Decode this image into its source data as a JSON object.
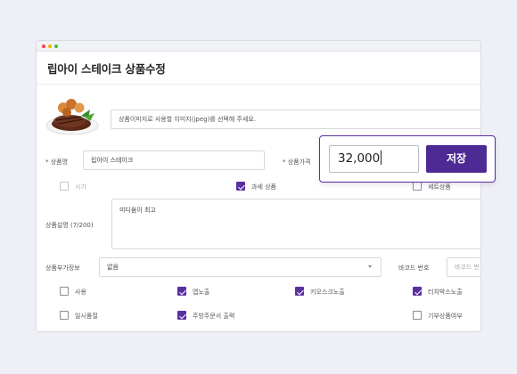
{
  "page": {
    "title": "립아이 스테이크 상품수정"
  },
  "image": {
    "placeholder": "상품이미지로 사용할 이미지(jpeg)를 선택해 주세요."
  },
  "product_name": {
    "label": "* 상품명",
    "value": "립아이 스테이크"
  },
  "price": {
    "label": "* 상품가격"
  },
  "flags_row1": {
    "market_price": {
      "label": "시가",
      "checked": false
    },
    "taxable": {
      "label": "과세 상품",
      "checked": true
    },
    "set_product": {
      "label": "세트상품",
      "checked": false
    }
  },
  "description": {
    "label": "상품설명 (7/200)",
    "value": "미디움이 최고"
  },
  "extra_info": {
    "label": "상품부가정보",
    "selected": "없음"
  },
  "barcode": {
    "label": "바코드 번호",
    "placeholder": "바코드 번"
  },
  "flags_row2": [
    {
      "label": "사용",
      "checked": false
    },
    {
      "label": "앱노출",
      "checked": true
    },
    {
      "label": "키오스크노출",
      "checked": true
    },
    {
      "label": "터치박스노출",
      "checked": true
    }
  ],
  "flags_row3": [
    {
      "label": "일시품절",
      "checked": false
    },
    {
      "label": "주방주문서 출력",
      "checked": true
    },
    {
      "label": "기부상품여부",
      "checked": false
    }
  ],
  "popup": {
    "price_value": "32,000",
    "save_label": "저장"
  },
  "colors": {
    "accent": "#4e2a94",
    "checkbox_on": "#5a2fa0",
    "background": "#eef0f5"
  }
}
